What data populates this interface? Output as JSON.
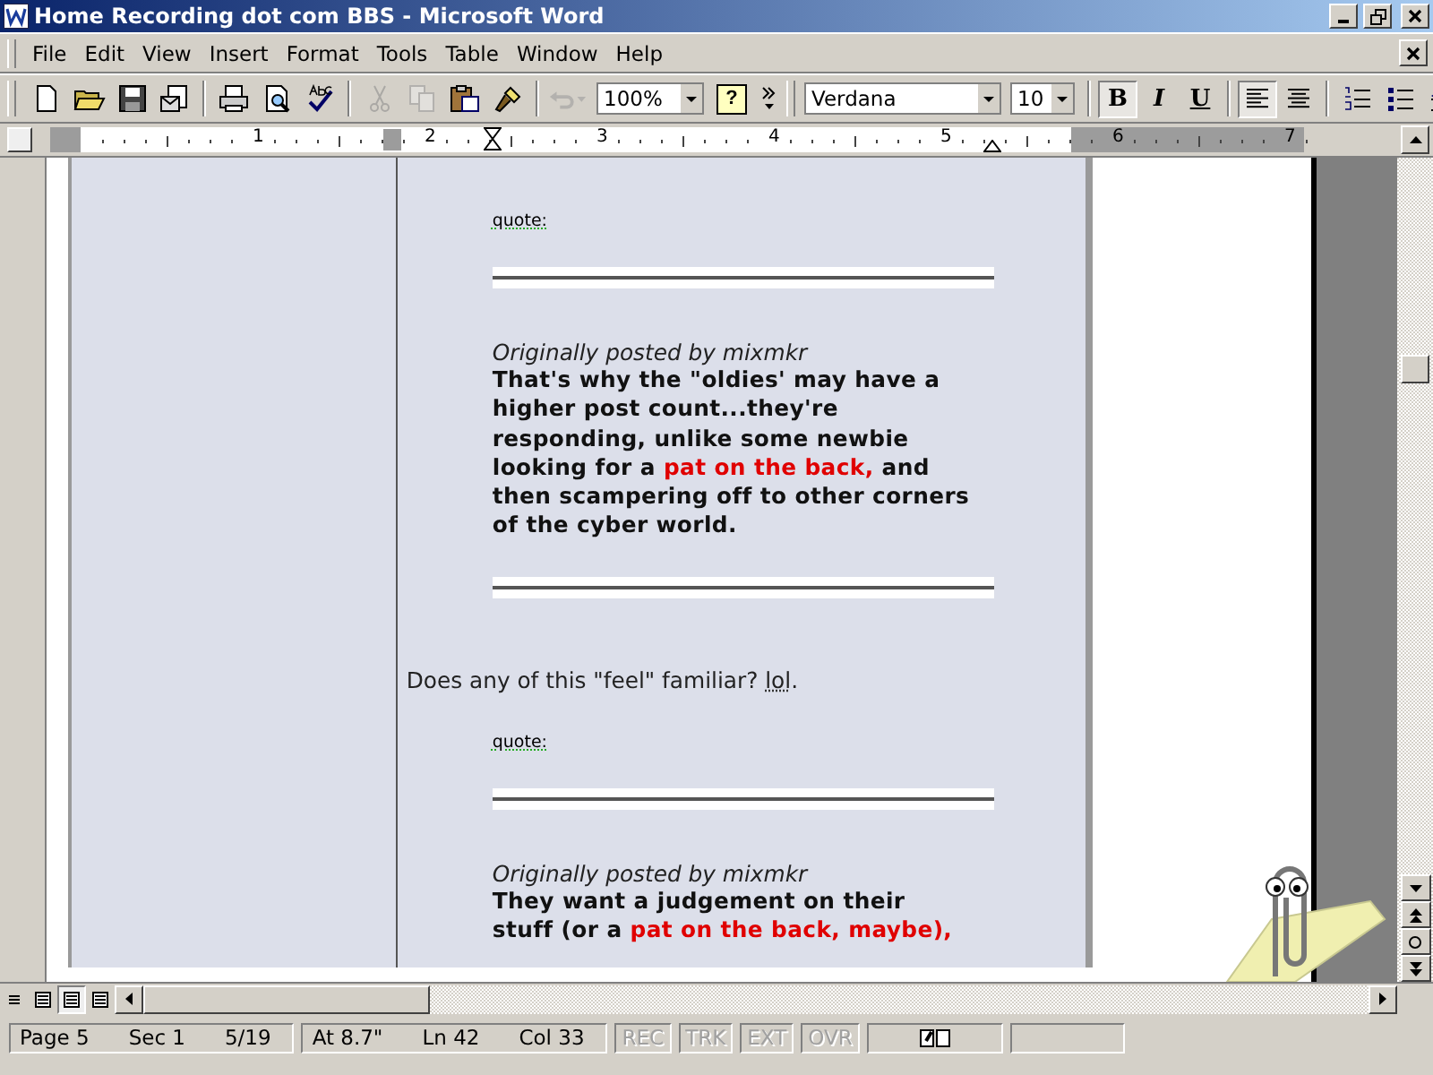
{
  "window": {
    "title": "Home Recording dot com BBS - Microsoft Word"
  },
  "menu": [
    {
      "label": "File"
    },
    {
      "label": "Edit"
    },
    {
      "label": "View"
    },
    {
      "label": "Insert"
    },
    {
      "label": "Format"
    },
    {
      "label": "Tools"
    },
    {
      "label": "Table"
    },
    {
      "label": "Window"
    },
    {
      "label": "Help"
    }
  ],
  "toolbar": {
    "buttons": [
      {
        "kind": "new",
        "disabled": false
      },
      {
        "kind": "open",
        "disabled": false
      },
      {
        "kind": "save",
        "disabled": false
      },
      {
        "kind": "email",
        "disabled": false
      },
      {
        "kind": "sep"
      },
      {
        "kind": "print",
        "disabled": false
      },
      {
        "kind": "preview",
        "disabled": false
      },
      {
        "kind": "spelling",
        "disabled": false
      },
      {
        "kind": "sep"
      },
      {
        "kind": "cut",
        "disabled": true
      },
      {
        "kind": "copy",
        "disabled": true
      },
      {
        "kind": "paste",
        "disabled": false
      },
      {
        "kind": "painter",
        "disabled": false
      },
      {
        "kind": "sep"
      },
      {
        "kind": "undo",
        "disabled": true
      }
    ],
    "zoom": "100%",
    "help_text": "?",
    "font": "Verdana",
    "size": "10",
    "format_buttons": [
      {
        "kind": "bold",
        "label": "B",
        "pressed": true
      },
      {
        "kind": "italic",
        "label": "I",
        "pressed": false
      },
      {
        "kind": "underline",
        "label": "U",
        "pressed": false
      }
    ],
    "align_buttons": [
      {
        "kind": "left",
        "pressed": true
      },
      {
        "kind": "center",
        "pressed": false
      }
    ],
    "list_buttons": [
      {
        "kind": "numbering"
      },
      {
        "kind": "bullets"
      },
      {
        "kind": "indent"
      }
    ]
  },
  "ruler": {
    "numbers": [
      "1",
      "2",
      "3",
      "4",
      "5",
      "6",
      "7"
    ]
  },
  "document": {
    "blocks": [
      {
        "kind": "label",
        "text": "quote:"
      },
      {
        "kind": "rule"
      },
      {
        "kind": "byline",
        "text": "Originally posted by mixmkr"
      },
      {
        "kind": "quote",
        "segments": [
          {
            "text": "That's why the \"oldies' may have a higher post count...they're responding, unlike some newbie looking for a ",
            "kind": "plain"
          },
          {
            "text": "pat on the back,",
            "kind": "highlight"
          },
          {
            "text": " and then scampering off to other corners of the cyber world.",
            "kind": "plain"
          }
        ]
      },
      {
        "kind": "rule"
      },
      {
        "kind": "paragraph",
        "segments": [
          {
            "text": "Does any of this \"feel\" familiar? ",
            "kind": "plain"
          },
          {
            "text": "lol",
            "kind": "flagged"
          },
          {
            "text": ".",
            "kind": "plain"
          }
        ]
      },
      {
        "kind": "label",
        "text": "quote:"
      },
      {
        "kind": "rule"
      },
      {
        "kind": "byline",
        "text": "Originally posted by mixmkr"
      },
      {
        "kind": "quote",
        "segments": [
          {
            "text": "They want a judgement on their stuff (or a ",
            "kind": "plain"
          },
          {
            "text": "pat on the back, maybe),",
            "kind": "highlight"
          }
        ]
      }
    ]
  },
  "status_bar": {
    "fields": [
      {
        "kind": "group",
        "items": [
          "Page 5",
          "Sec 1",
          "5/19"
        ]
      },
      {
        "kind": "group",
        "items": [
          "At 8.7\"",
          "Ln 42",
          "Col 33"
        ]
      }
    ],
    "modes": [
      {
        "label": "REC",
        "disabled": true
      },
      {
        "label": "TRK",
        "disabled": true
      },
      {
        "label": "EXT",
        "disabled": true
      },
      {
        "label": "OVR",
        "disabled": true
      }
    ]
  }
}
